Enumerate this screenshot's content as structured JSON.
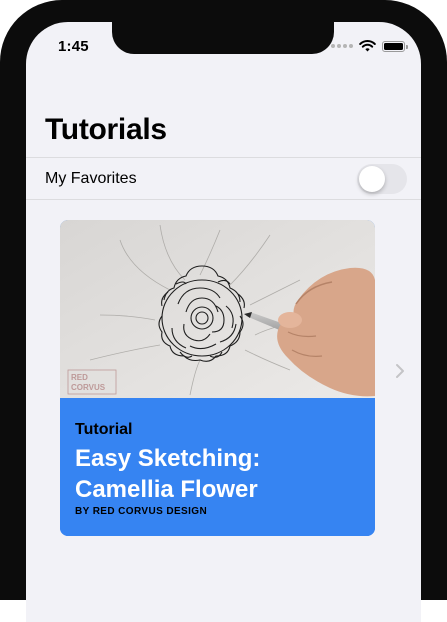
{
  "status_bar": {
    "time": "1:45"
  },
  "header": {
    "title": "Tutorials"
  },
  "favorites_row": {
    "label": "My Favorites",
    "toggle_on": false
  },
  "card": {
    "kicker": "Tutorial",
    "title": "Easy Sketching: Camellia Flower",
    "byline": "BY RED CORVUS DESIGN",
    "watermark": "RED CORVUS",
    "background_color": "#3684f2"
  },
  "icons": [
    "wifi-icon",
    "battery-icon",
    "chevron-right-icon"
  ]
}
